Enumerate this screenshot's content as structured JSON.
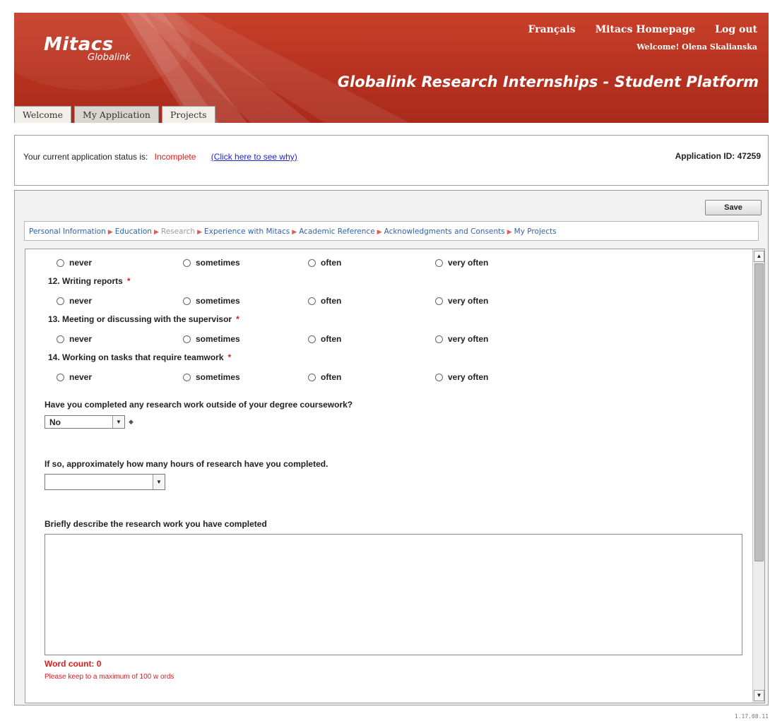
{
  "header": {
    "logo_main": "Mitacs",
    "logo_sub": "Globalink",
    "links": [
      "Français",
      "Mitacs Homepage",
      "Log out"
    ],
    "welcome": "Welcome! Olena Skalianska",
    "platform_title": "Globalink Research Internships - Student Platform",
    "tabs": [
      "Welcome",
      "My Application",
      "Projects"
    ],
    "active_tab": "My Application",
    "brand_color": "#b73220"
  },
  "status": {
    "label": "Your current application status is:",
    "value": "Incomplete",
    "why_link": "(Click here to see why)",
    "app_id_label": "Application ID:",
    "app_id": "47259"
  },
  "toolbar": {
    "save_label": "Save"
  },
  "breadcrumb": [
    {
      "label": "Personal Information",
      "current": false
    },
    {
      "label": "Education",
      "current": false
    },
    {
      "label": "Research",
      "current": true
    },
    {
      "label": "Experience with Mitacs",
      "current": false
    },
    {
      "label": "Academic Reference",
      "current": false
    },
    {
      "label": "Acknowledgments and Consents",
      "current": false
    },
    {
      "label": "My Projects",
      "current": false
    }
  ],
  "frequency_options": [
    "never",
    "sometimes",
    "often",
    "very often"
  ],
  "questions": [
    {
      "number": "12.",
      "text": "Writing reports"
    },
    {
      "number": "13.",
      "text": "Meeting or discussing with the supervisor"
    },
    {
      "number": "14.",
      "text": "Working on tasks that require teamwork"
    }
  ],
  "required_marker": "*",
  "research_outside": {
    "question": "Have you completed any research work outside of your degree coursework?",
    "value": "No",
    "marker": "◆"
  },
  "hours": {
    "question": "If so, approximately how many hours of research have you completed.",
    "value": ""
  },
  "describe": {
    "question": "Briefly describe the research work you have completed",
    "value": "",
    "word_count": "Word count: 0",
    "max_note": "Please keep to a maximum of 100 w ords"
  },
  "scroll_up_icon": "▲",
  "scroll_down_icon": "▼",
  "select_arrow_icon": "▼",
  "crumb_arrow_icon": "▶",
  "version": "1.17.08.11"
}
